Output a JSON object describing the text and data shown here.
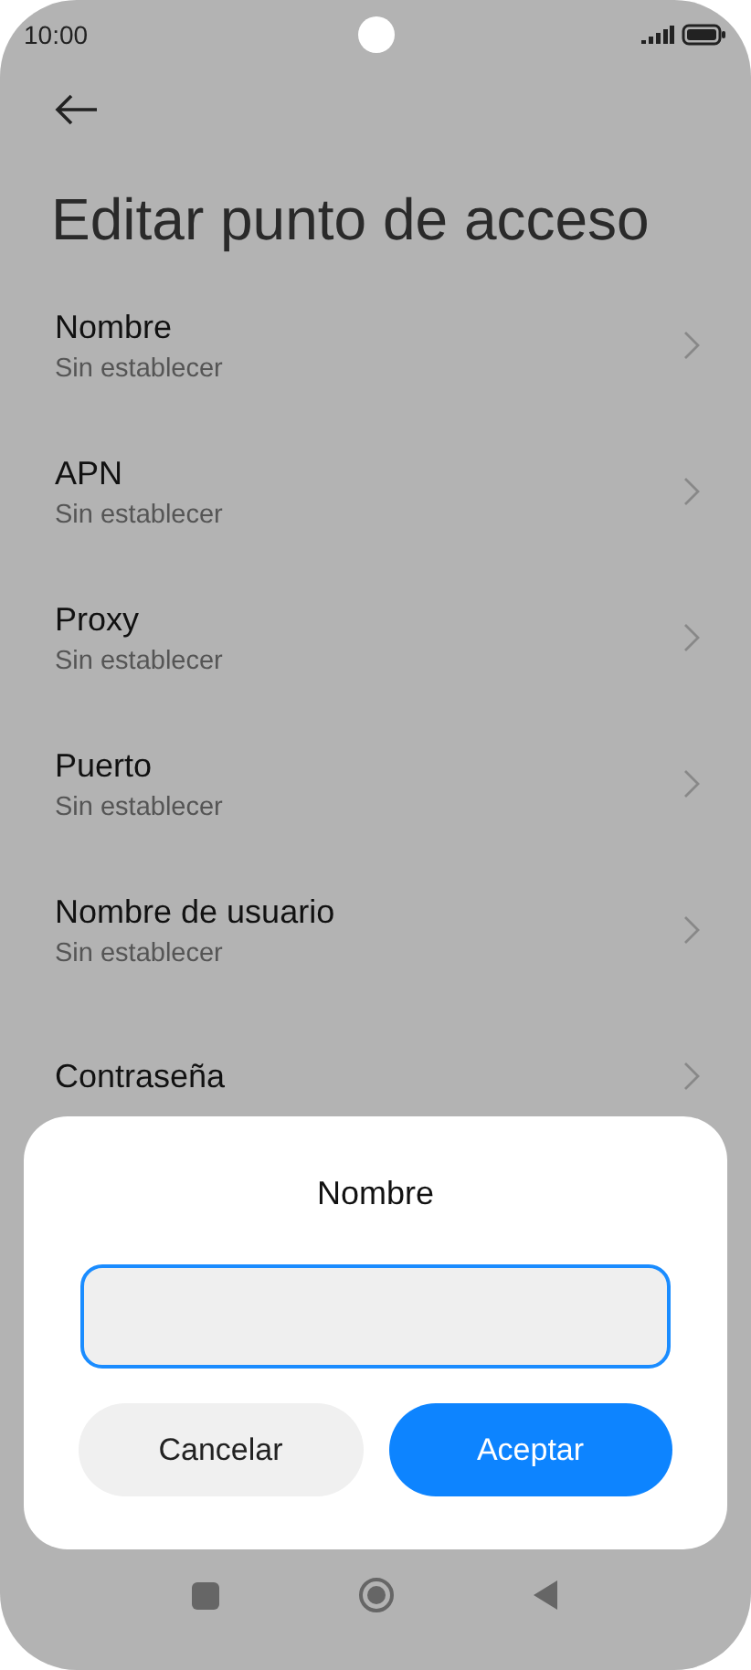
{
  "status_bar": {
    "time": "10:00"
  },
  "title": "Editar punto de acceso",
  "items": [
    {
      "label": "Nombre",
      "value": "Sin establecer"
    },
    {
      "label": "APN",
      "value": "Sin establecer"
    },
    {
      "label": "Proxy",
      "value": "Sin establecer"
    },
    {
      "label": "Puerto",
      "value": "Sin establecer"
    },
    {
      "label": "Nombre de usuario",
      "value": "Sin establecer"
    },
    {
      "label": "Contraseña"
    }
  ],
  "dialog": {
    "title": "Nombre",
    "input": {
      "focused": true
    },
    "buttons": [
      {
        "label": "Cancelar",
        "kind": "secondary"
      },
      {
        "label": "Aceptar",
        "kind": "primary"
      }
    ]
  }
}
